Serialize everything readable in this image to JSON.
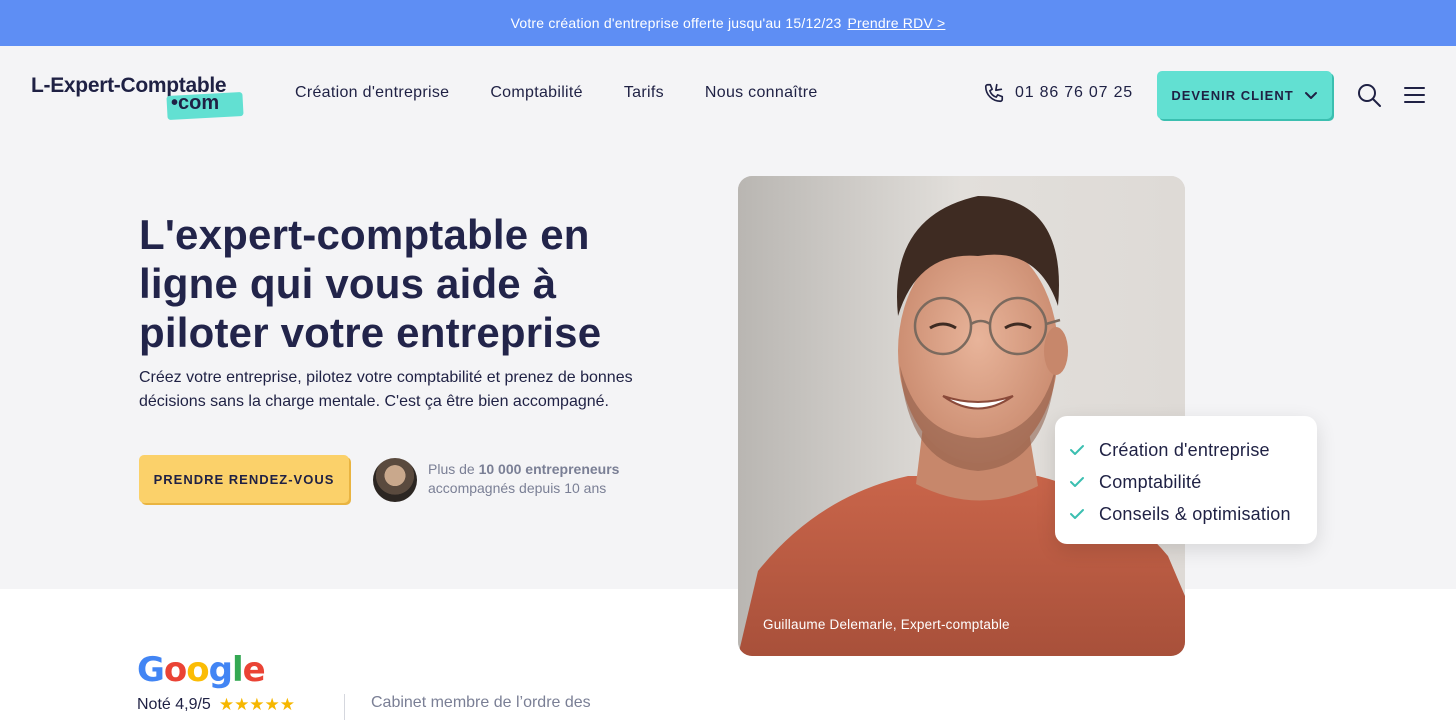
{
  "promo": {
    "text": "Votre création d'entreprise offerte jusqu'au 15/12/23",
    "link": "Prendre RDV >"
  },
  "header": {
    "logo_main": "L-Expert-Comptable",
    "logo_suffix": "•com",
    "nav": [
      "Création d'entreprise",
      "Comptabilité",
      "Tarifs",
      "Nous connaître"
    ],
    "phone": "01 86 76 07 25",
    "cta_label": "DEVENIR CLIENT",
    "icons": {
      "phone": "phone-icon",
      "search": "search-icon",
      "menu": "hamburger-menu-icon",
      "chevron": "chevron-down-icon"
    }
  },
  "hero": {
    "title": "L'expert-comptable en ligne qui vous aide à piloter votre entreprise",
    "subtitle": "Créez votre entreprise, pilotez votre comptabilité et prenez de bonnes décisions sans la charge mentale. C'est ça être bien accompagné.",
    "cta_label": "PRENDRE RENDEZ-VOUS",
    "trust_prefix": "Plus de ",
    "trust_bold": "10 000 entrepreneurs",
    "trust_line2": "accompagnés depuis 10 ans",
    "photo_caption": "Guillaume Delemarle, Expert-comptable",
    "features": [
      "Création d'entreprise",
      "Comptabilité",
      "Conseils & optimisation"
    ]
  },
  "reviews": {
    "google": "Google",
    "rating": "Noté 4,9/5",
    "ordre": "Cabinet membre de l’ordre des"
  },
  "colors": {
    "promo_bg": "#5e8ef4",
    "accent_teal": "#62e0d2",
    "accent_yellow": "#fbd16a",
    "text_dark": "#1f2144",
    "star": "#f6b700"
  }
}
